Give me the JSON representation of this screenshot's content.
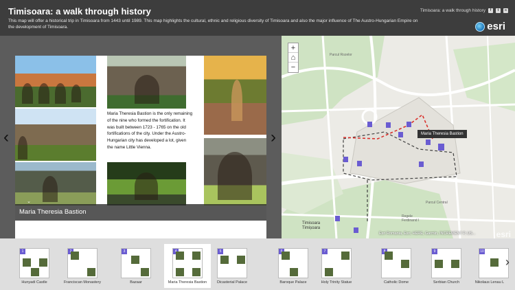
{
  "header": {
    "title": "Timisoara: a walk through history",
    "description": "This map will offer a historical trip in Timisoara from 1443 until 1989. This map highlights the cultural, ethnic and religious diversity of Timisoara and also the major influence of The Austro-Hungarian Empire on the development of Timisoara.",
    "share_title": "Timisoara: a walk through history",
    "logo": "esri"
  },
  "story": {
    "text": "Maria Theresia Bastion is the only remaining of the nine who formed the fortification. It was built between 1723 - 1765 on the old fortifications of the city. Under the Austro-Hungarian city has developed a lot, given the name Little Vienna.",
    "caption": "Maria Theresia Bastion"
  },
  "map": {
    "tooltip": "Maria Theresia Bastion",
    "attribution": "Esri Romania, Esri, HERE, Garmin, INCREMENT P, US...",
    "watermark": "esri",
    "labels": [
      "Timisoara",
      "Timișoara",
      "Parcul Rozelor",
      "Parcul Central",
      "Regele",
      "Ferdinand I"
    ]
  },
  "carousel": {
    "items": [
      {
        "num": "1",
        "label": "Hunyadi Castle"
      },
      {
        "num": "2",
        "label": "Franciscan Monastery"
      },
      {
        "num": "3",
        "label": "Bazaar"
      },
      {
        "num": "4",
        "label": "Maria Theresia Bastion"
      },
      {
        "num": "5",
        "label": "Dicasterial Palace"
      },
      {
        "num": "6",
        "label": "Baroque Palace"
      },
      {
        "num": "7",
        "label": "Holy Trinity Statue"
      },
      {
        "num": "8",
        "label": "Catholic Dome"
      },
      {
        "num": "9",
        "label": "Serbian Church"
      },
      {
        "num": "10",
        "label": "Nikolaus Lenau L"
      }
    ]
  },
  "colors": {
    "header_bg": "#3d3d3d",
    "marker": "#6a5cd1",
    "route_red": "#d9302b"
  }
}
